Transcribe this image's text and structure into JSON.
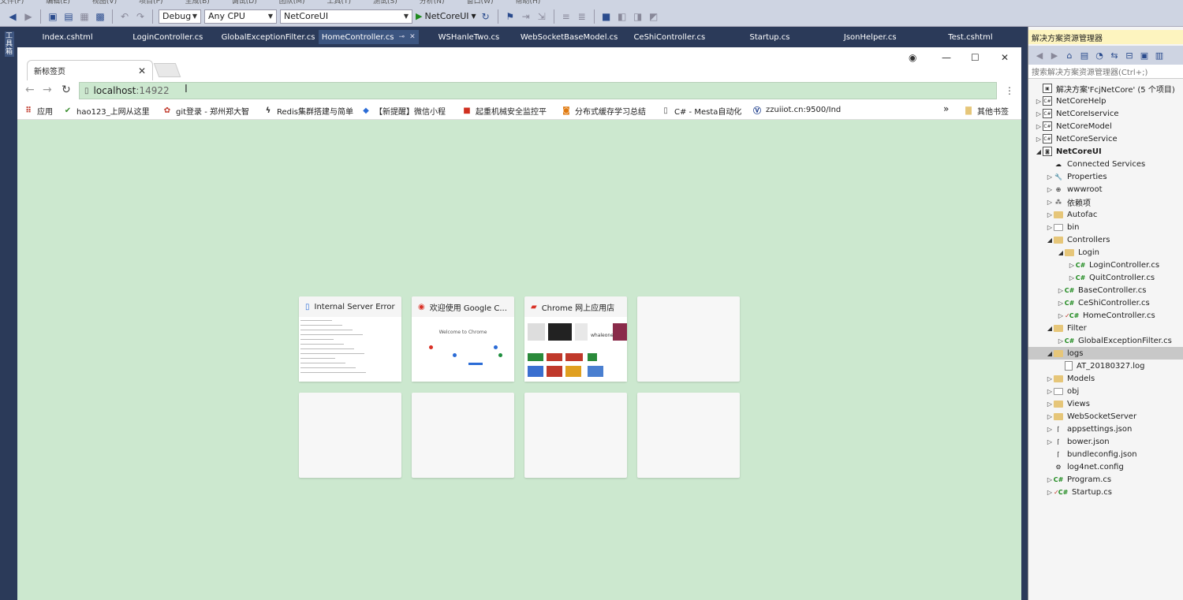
{
  "vs": {
    "menu": [
      "文件(F)",
      "编辑(E)",
      "视图(V)",
      "项目(P)",
      "生成(B)",
      "调试(D)",
      "团队(M)",
      "工具(T)",
      "测试(S)",
      "分析(N)",
      "窗口(W)",
      "帮助(H)"
    ],
    "toolbar": {
      "config": "Debug",
      "platform": "Any CPU",
      "startup_project": "NetCoreUI",
      "run_label": "NetCoreUI"
    },
    "left_strip_label": "工具箱",
    "tabs": [
      "Index.cshtml",
      "LoginController.cs",
      "GlobalExceptionFilter.cs",
      "HomeController.cs",
      "WSHanleTwo.cs",
      "WebSocketBaseModel.cs",
      "CeShiController.cs",
      "Startup.cs",
      "JsonHelper.cs",
      "Test.cshtml"
    ]
  },
  "browser": {
    "tab_title": "新标签页",
    "address": {
      "host": "localhost",
      "port": ":14922"
    },
    "bookmarks": [
      "应用",
      "hao123_上网从这里",
      "git登录 - 郑州郑大智",
      "Redis集群搭建与简单",
      "【新提醒】微信小程",
      "起重机械安全监控平",
      "分布式缓存学习总结",
      "C# - Mesta自动化",
      "zzuiiot.cn:9500/Ind"
    ],
    "overflow": "»",
    "other_bookmarks": "其他书签",
    "tiles": [
      {
        "title": "Internal Server Error",
        "icon": "page-icon",
        "thumb": "error-page"
      },
      {
        "title": "欢迎使用 Google C...",
        "icon": "chrome-icon",
        "thumb": "welcome"
      },
      {
        "title": "Chrome 网上应用店",
        "icon": "webstore-icon",
        "thumb": "store"
      },
      {
        "title": "",
        "icon": "",
        "thumb": "blank"
      },
      {
        "title": "",
        "icon": "",
        "thumb": "blank"
      },
      {
        "title": "",
        "icon": "",
        "thumb": "blank"
      },
      {
        "title": "",
        "icon": "",
        "thumb": "blank"
      },
      {
        "title": "",
        "icon": "",
        "thumb": "blank"
      }
    ],
    "thumb_text": {
      "welcome": "Welcome to Chrome",
      "store": "whaleone"
    }
  },
  "solution_explorer": {
    "title": "解决方案资源管理器",
    "search_placeholder": "搜索解决方案资源管理器(Ctrl+;)",
    "items": [
      {
        "label": "解决方案'FcjNetCore' (5 个项目)",
        "type": "solution",
        "depth": 0,
        "exp": ""
      },
      {
        "label": "NetCoreHelp",
        "type": "proj",
        "depth": 0,
        "exp": "▷"
      },
      {
        "label": "NetCoreIservice",
        "type": "proj",
        "depth": 0,
        "exp": "▷"
      },
      {
        "label": "NetCoreModel",
        "type": "proj",
        "depth": 0,
        "exp": "▷"
      },
      {
        "label": "NetCoreService",
        "type": "proj",
        "depth": 0,
        "exp": "▷"
      },
      {
        "label": "NetCoreUI",
        "type": "proj-web",
        "depth": 0,
        "exp": "◢",
        "bold": true
      },
      {
        "label": "Connected Services",
        "type": "cloud",
        "depth": 1,
        "exp": ""
      },
      {
        "label": "Properties",
        "type": "wrench",
        "depth": 1,
        "exp": "▷"
      },
      {
        "label": "wwwroot",
        "type": "globe",
        "depth": 1,
        "exp": "▷"
      },
      {
        "label": "依赖项",
        "type": "deps",
        "depth": 1,
        "exp": "▷"
      },
      {
        "label": "Autofac",
        "type": "folder",
        "depth": 1,
        "exp": "▷"
      },
      {
        "label": "bin",
        "type": "folder-empty",
        "depth": 1,
        "exp": "▷"
      },
      {
        "label": "Controllers",
        "type": "folder",
        "depth": 1,
        "exp": "◢"
      },
      {
        "label": "Login",
        "type": "folder",
        "depth": 2,
        "exp": "◢"
      },
      {
        "label": "LoginController.cs",
        "type": "cs",
        "depth": 3,
        "exp": "▷"
      },
      {
        "label": "QuitController.cs",
        "type": "cs",
        "depth": 3,
        "exp": "▷"
      },
      {
        "label": "BaseController.cs",
        "type": "cs",
        "depth": 2,
        "exp": "▷"
      },
      {
        "label": "CeShiController.cs",
        "type": "cs",
        "depth": 2,
        "exp": "▷"
      },
      {
        "label": "HomeController.cs",
        "type": "cs",
        "depth": 2,
        "exp": "▷",
        "check": true
      },
      {
        "label": "Filter",
        "type": "folder",
        "depth": 1,
        "exp": "◢"
      },
      {
        "label": "GlobalExceptionFilter.cs",
        "type": "cs",
        "depth": 2,
        "exp": "▷"
      },
      {
        "label": "logs",
        "type": "folder",
        "depth": 1,
        "exp": "◢",
        "selected": true
      },
      {
        "label": "AT_20180327.log",
        "type": "file",
        "depth": 2,
        "exp": ""
      },
      {
        "label": "Models",
        "type": "folder",
        "depth": 1,
        "exp": "▷"
      },
      {
        "label": "obj",
        "type": "folder-empty",
        "depth": 1,
        "exp": "▷"
      },
      {
        "label": "Views",
        "type": "folder",
        "depth": 1,
        "exp": "▷"
      },
      {
        "label": "WebSocketServer",
        "type": "folder",
        "depth": 1,
        "exp": "▷"
      },
      {
        "label": "appsettings.json",
        "type": "json",
        "depth": 1,
        "exp": "▷"
      },
      {
        "label": "bower.json",
        "type": "json",
        "depth": 1,
        "exp": "▷"
      },
      {
        "label": "bundleconfig.json",
        "type": "json",
        "depth": 1,
        "exp": ""
      },
      {
        "label": "log4net.config",
        "type": "config",
        "depth": 1,
        "exp": ""
      },
      {
        "label": "Program.cs",
        "type": "cs",
        "depth": 1,
        "exp": "▷"
      },
      {
        "label": "Startup.cs",
        "type": "cs",
        "depth": 1,
        "exp": "▷",
        "check": true
      }
    ]
  }
}
